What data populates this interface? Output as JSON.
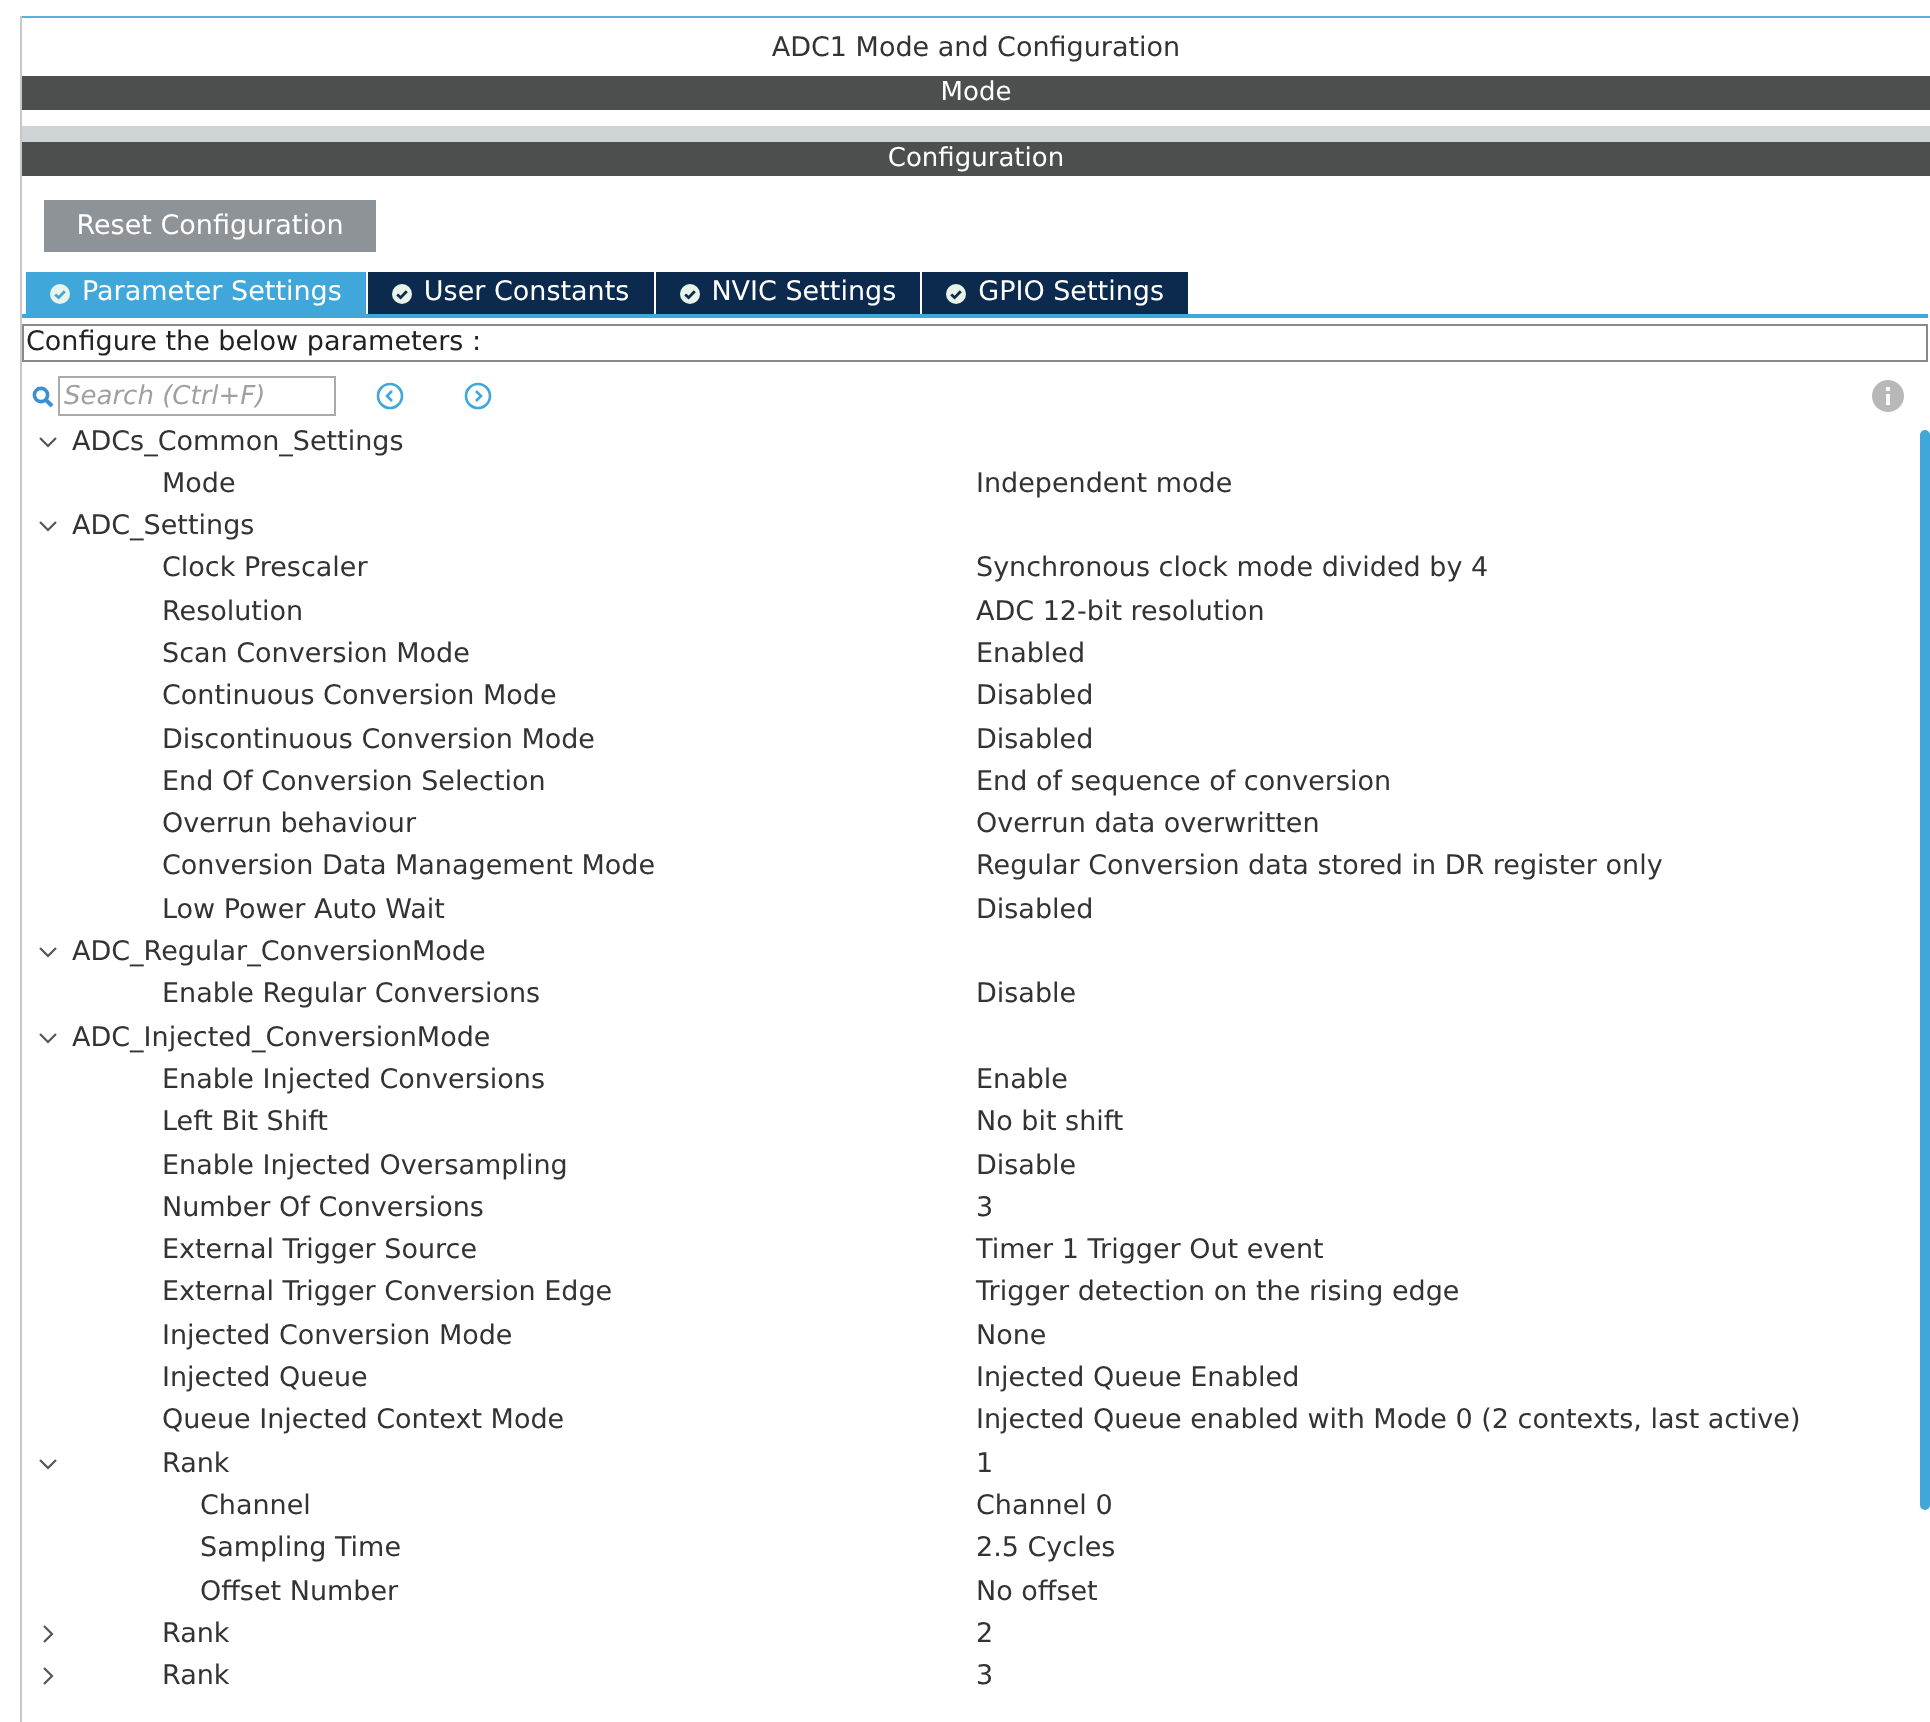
{
  "title": "ADC1 Mode and Configuration",
  "mode_bar": "Mode",
  "configuration_bar": "Configuration",
  "reset_button": "Reset Configuration",
  "tabs": [
    {
      "label": "Parameter Settings",
      "selected": true
    },
    {
      "label": "User Constants",
      "selected": false
    },
    {
      "label": "NVIC Settings",
      "selected": false
    },
    {
      "label": "GPIO Settings",
      "selected": false
    }
  ],
  "instruction": "Configure the below parameters :",
  "search": {
    "placeholder": "Search (Ctrl+F)"
  },
  "tree": [
    {
      "label": "ADCs_Common_Settings",
      "expanded": true,
      "children": [
        {
          "label": "Mode",
          "value": "Independent mode"
        }
      ]
    },
    {
      "label": "ADC_Settings",
      "expanded": true,
      "children": [
        {
          "label": "Clock Prescaler",
          "value": "Synchronous clock mode divided by 4"
        },
        {
          "label": "Resolution",
          "value": "ADC 12-bit resolution"
        },
        {
          "label": "Scan Conversion Mode",
          "value": "Enabled"
        },
        {
          "label": "Continuous Conversion Mode",
          "value": "Disabled"
        },
        {
          "label": "Discontinuous Conversion Mode",
          "value": "Disabled"
        },
        {
          "label": "End Of Conversion Selection",
          "value": "End of sequence of conversion"
        },
        {
          "label": "Overrun behaviour",
          "value": "Overrun data overwritten"
        },
        {
          "label": "Conversion Data Management Mode",
          "value": "Regular Conversion data stored in DR register only"
        },
        {
          "label": "Low Power Auto Wait",
          "value": "Disabled"
        }
      ]
    },
    {
      "label": "ADC_Regular_ConversionMode",
      "expanded": true,
      "children": [
        {
          "label": "Enable Regular Conversions",
          "value": "Disable"
        }
      ]
    },
    {
      "label": "ADC_Injected_ConversionMode",
      "expanded": true,
      "children": [
        {
          "label": "Enable Injected Conversions",
          "value": "Enable"
        },
        {
          "label": "Left Bit Shift",
          "value": "No bit shift"
        },
        {
          "label": "Enable Injected Oversampling",
          "value": "Disable"
        },
        {
          "label": "Number Of Conversions",
          "value": "3"
        },
        {
          "label": "External Trigger Source",
          "value": "Timer 1 Trigger Out event"
        },
        {
          "label": "External Trigger Conversion Edge",
          "value": "Trigger detection on the rising edge"
        },
        {
          "label": "Injected Conversion Mode",
          "value": "None"
        },
        {
          "label": "Injected Queue",
          "value": "Injected Queue Enabled"
        },
        {
          "label": "Queue Injected Context Mode",
          "value": "Injected Queue enabled with Mode 0 (2 contexts, last active)"
        },
        {
          "label": "Rank",
          "value": "1",
          "expanded": true,
          "children": [
            {
              "label": "Channel",
              "value": "Channel 0"
            },
            {
              "label": "Sampling Time",
              "value": "2.5 Cycles"
            },
            {
              "label": "Offset Number",
              "value": "No offset"
            }
          ]
        },
        {
          "label": "Rank",
          "value": "2",
          "expanded": false
        },
        {
          "label": "Rank",
          "value": "3",
          "expanded": false
        }
      ]
    }
  ]
}
